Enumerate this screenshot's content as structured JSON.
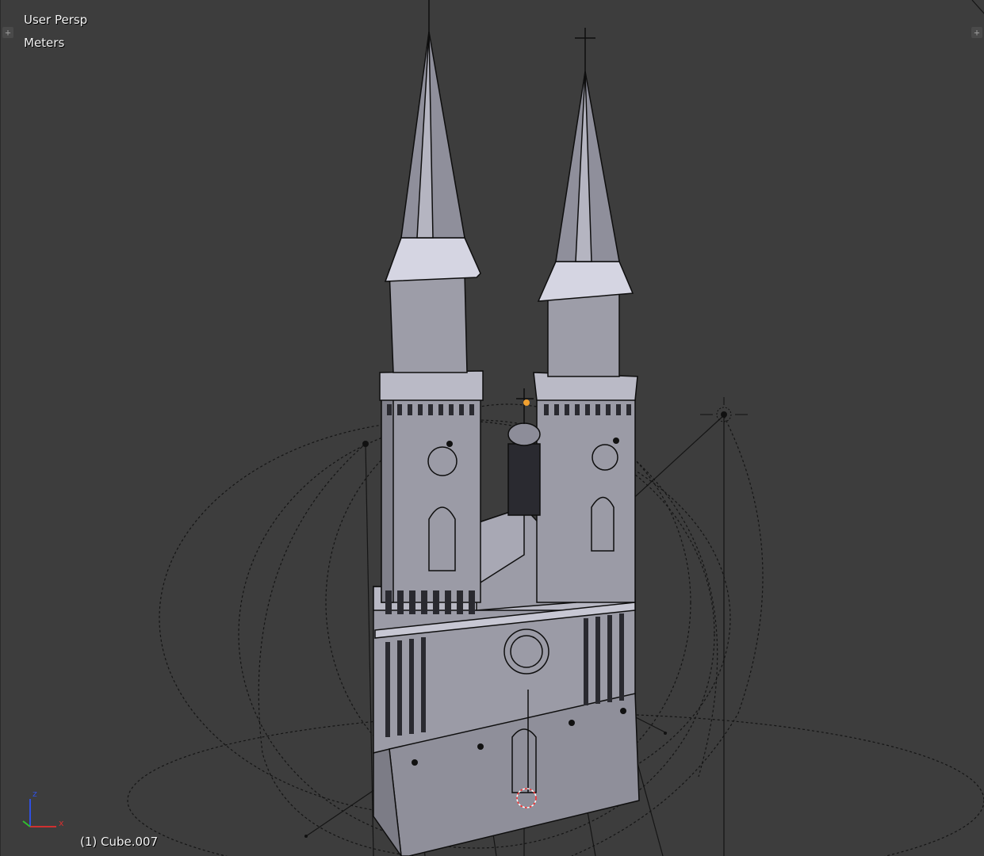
{
  "viewport": {
    "view_label": "User Persp",
    "units_label": "Meters",
    "active_object_label": "(1) Cube.007",
    "axes": {
      "z": "z",
      "x": "x"
    },
    "colors": {
      "background": "#3d3d3d",
      "mesh_face": "#8a8a94",
      "mesh_face_light": "#c9c9d6",
      "wire": "#111111",
      "axis_x": "#d03030",
      "axis_y": "#30c030",
      "axis_z": "#3050e0",
      "selection": "#ff7a00"
    },
    "icons": [
      "area-split-plus-icon",
      "area-split-plus-icon",
      "axis-gizmo-icon",
      "lamp-icon",
      "empty-icon"
    ]
  }
}
